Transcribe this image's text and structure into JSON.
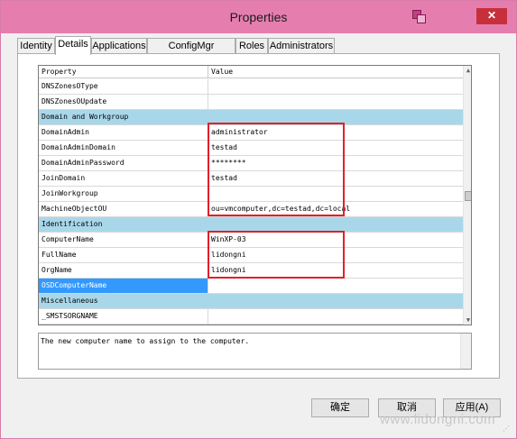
{
  "window": {
    "title": "Properties",
    "close_label": "✕"
  },
  "tabs": [
    {
      "label": "Identity"
    },
    {
      "label": "Details"
    },
    {
      "label": "Applications"
    },
    {
      "label": "ConfigMgr Packages"
    },
    {
      "label": "Roles"
    },
    {
      "label": "Administrators"
    }
  ],
  "active_tab": "Details",
  "grid": {
    "headers": {
      "property": "Property",
      "value": "Value"
    },
    "rows": [
      {
        "name": "DNSZonesOType",
        "value": "",
        "type": "prop"
      },
      {
        "name": "DNSZonesOUpdate",
        "value": "",
        "type": "prop"
      },
      {
        "name": "Domain and Workgroup",
        "value": "",
        "type": "category"
      },
      {
        "name": "DomainAdmin",
        "value": "administrator",
        "type": "prop"
      },
      {
        "name": "DomainAdminDomain",
        "value": "testad",
        "type": "prop"
      },
      {
        "name": "DomainAdminPassword",
        "value": "********",
        "type": "prop"
      },
      {
        "name": "JoinDomain",
        "value": "testad",
        "type": "prop"
      },
      {
        "name": "JoinWorkgroup",
        "value": "",
        "type": "prop"
      },
      {
        "name": "MachineObjectOU",
        "value": "ou=vmcomputer,dc=testad,dc=local",
        "type": "prop"
      },
      {
        "name": "Identification",
        "value": "",
        "type": "category"
      },
      {
        "name": "ComputerName",
        "value": "WinXP-03",
        "type": "prop"
      },
      {
        "name": "FullName",
        "value": "lidongni",
        "type": "prop"
      },
      {
        "name": "OrgName",
        "value": "lidongni",
        "type": "prop"
      },
      {
        "name": "OSDComputerName",
        "value": "",
        "type": "selected"
      },
      {
        "name": "Miscellaneous",
        "value": "",
        "type": "category"
      },
      {
        "name": "_SMSTSORGNAME",
        "value": "",
        "type": "prop"
      }
    ]
  },
  "description": "The new computer name to assign to the computer.",
  "buttons": {
    "ok": "确定",
    "cancel": "取消",
    "apply": "应用(A)"
  },
  "watermark": "www.lidongni.com",
  "colors": {
    "titlebar": "#e57eaf",
    "category_row": "#a9d7ea",
    "selection": "#3399ff",
    "highlight_box": "#e0202a"
  }
}
